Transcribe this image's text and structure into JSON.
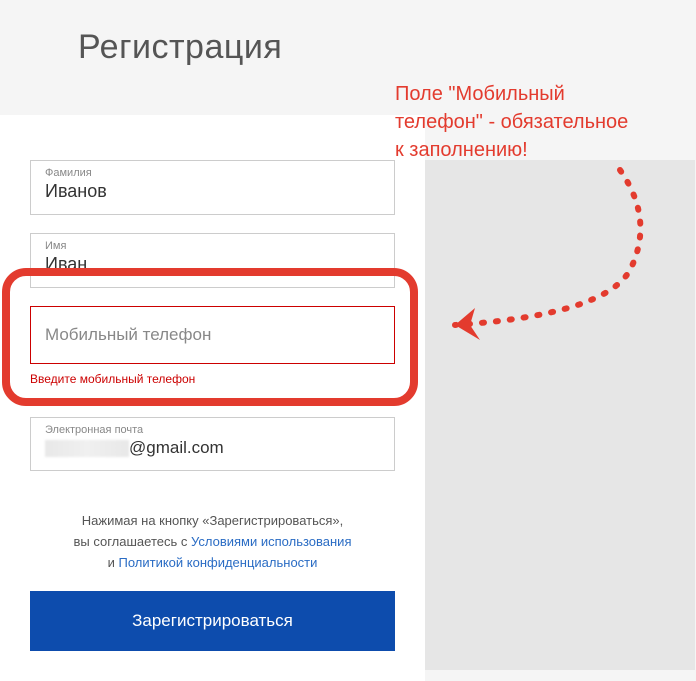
{
  "title": "Регистрация",
  "form": {
    "surname": {
      "label": "Фамилия",
      "value": "Иванов"
    },
    "name": {
      "label": "Имя",
      "value": "Иван"
    },
    "phone": {
      "placeholder": "Мобильный телефон",
      "error": "Введите мобильный телефон"
    },
    "email": {
      "label": "Электронная почта",
      "value_suffix": "@gmail.com"
    },
    "consent": {
      "line1_prefix": "Нажимая на кнопку «Зарегистрироваться»,",
      "line2_prefix": "вы соглашаетесь с ",
      "terms_link": "Условиями использования",
      "line3_prefix": "и ",
      "privacy_link": "Политикой конфиденциальности"
    },
    "submit": "Зарегистрироваться"
  },
  "annotation": {
    "line1": "Поле \"Мобильный",
    "line2": "телефон\" - обязательное",
    "line3": "к заполнению!"
  }
}
